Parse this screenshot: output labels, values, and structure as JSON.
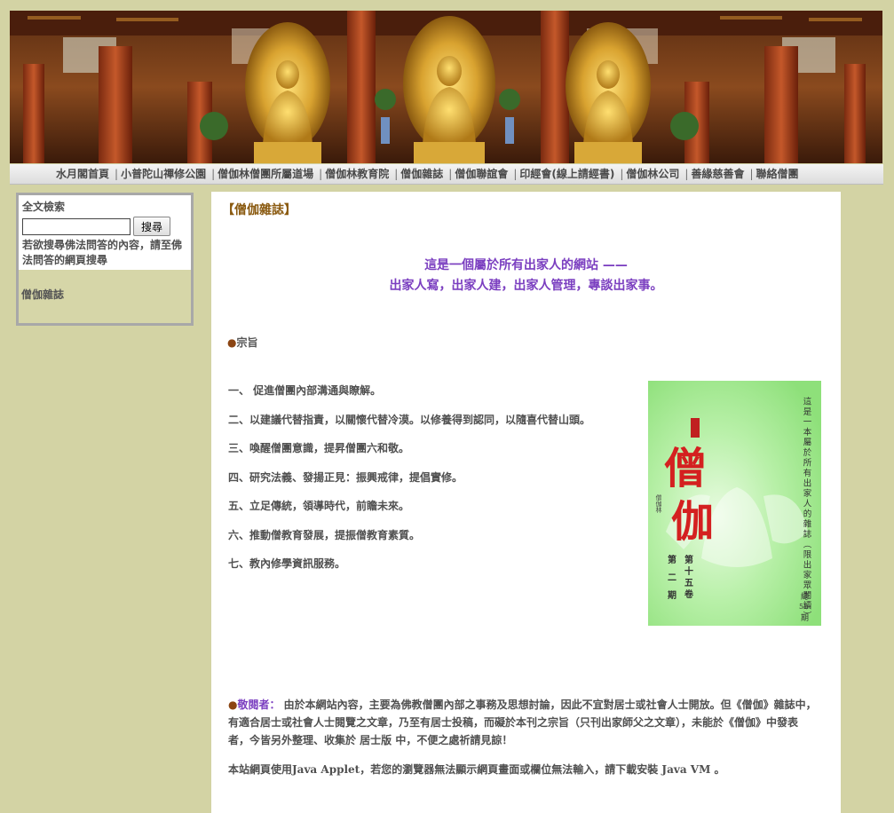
{
  "nav": {
    "items": [
      "水月閣首頁",
      "小普陀山禪修公園",
      "僧伽林僧團所屬道場",
      "僧伽林教育院",
      "僧伽雜誌",
      "僧伽聯誼會",
      "印經會(線上請經書)",
      "僧伽林公司",
      "善緣慈善會",
      "聯絡僧團"
    ]
  },
  "sidebar": {
    "search_title": "全文檢索",
    "search_value": "",
    "search_button": "搜尋",
    "search_hint": "若欲搜尋佛法問答的內容，請至佛法問答的網頁搜尋",
    "link": "僧伽雜誌"
  },
  "main": {
    "section_title": "【僧伽雜誌】",
    "slogan_line1": "這是一個屬於所有出家人的網站 ——",
    "slogan_line2": "出家人寫，出家人建，出家人管理，專談出家事。",
    "bullet": "●",
    "purpose_heading": "宗旨",
    "goals": [
      "一、 促進僧團內部溝通與瞭解。",
      "二、以建議代替指責，以關懷代替冷漠。以修養得到認同，以隨喜代替山頭。",
      "三、喚醒僧團意識，提昇僧團六和敬。",
      "四、研究法義、發揚正見：振興戒律，提倡實修。",
      "五、立足傳統，領導時代，前瞻未來。",
      "六、推動僧教育發展，提振僧教育素質。",
      "七、教內修學資訊服務。"
    ],
    "notice_label": "敬閱者：",
    "notice_text": " 由於本網站內容，主要為佛教僧團內部之事務及思想討論，因此不宜對居士或社會人士開放。但《僧伽》雜誌中，有適合居士或社會人士閱覽之文章，乃至有居士投稿，而礙於本刊之宗旨（只刊出家師父之文章），未能於《僧伽》中發表者，今皆另外整理、收集於 居士版 中，不便之處祈請見諒！",
    "java_note": "本站網頁使用Java Applet，若您的瀏覽器無法顯示網頁畫面或欄位無法輸入，請下載安裝 Java VM 。"
  },
  "cover": {
    "vertical_text": "這是一本屬於所有出家人的雜誌（限出家眾閱讀）",
    "title_char1": "僧",
    "title_char2": "伽",
    "volume": "第十五卷",
    "issue": "第二期",
    "total_label": "總",
    "total_num": "58",
    "total_unit": "期",
    "seal_text": "僧伽林"
  },
  "colors": {
    "page_bg": "#d3d3a4",
    "slogan": "#7b3fc0",
    "title": "#8a5a10",
    "text": "#505050",
    "cover_green": "#a8e898",
    "cover_red": "#d42020"
  }
}
